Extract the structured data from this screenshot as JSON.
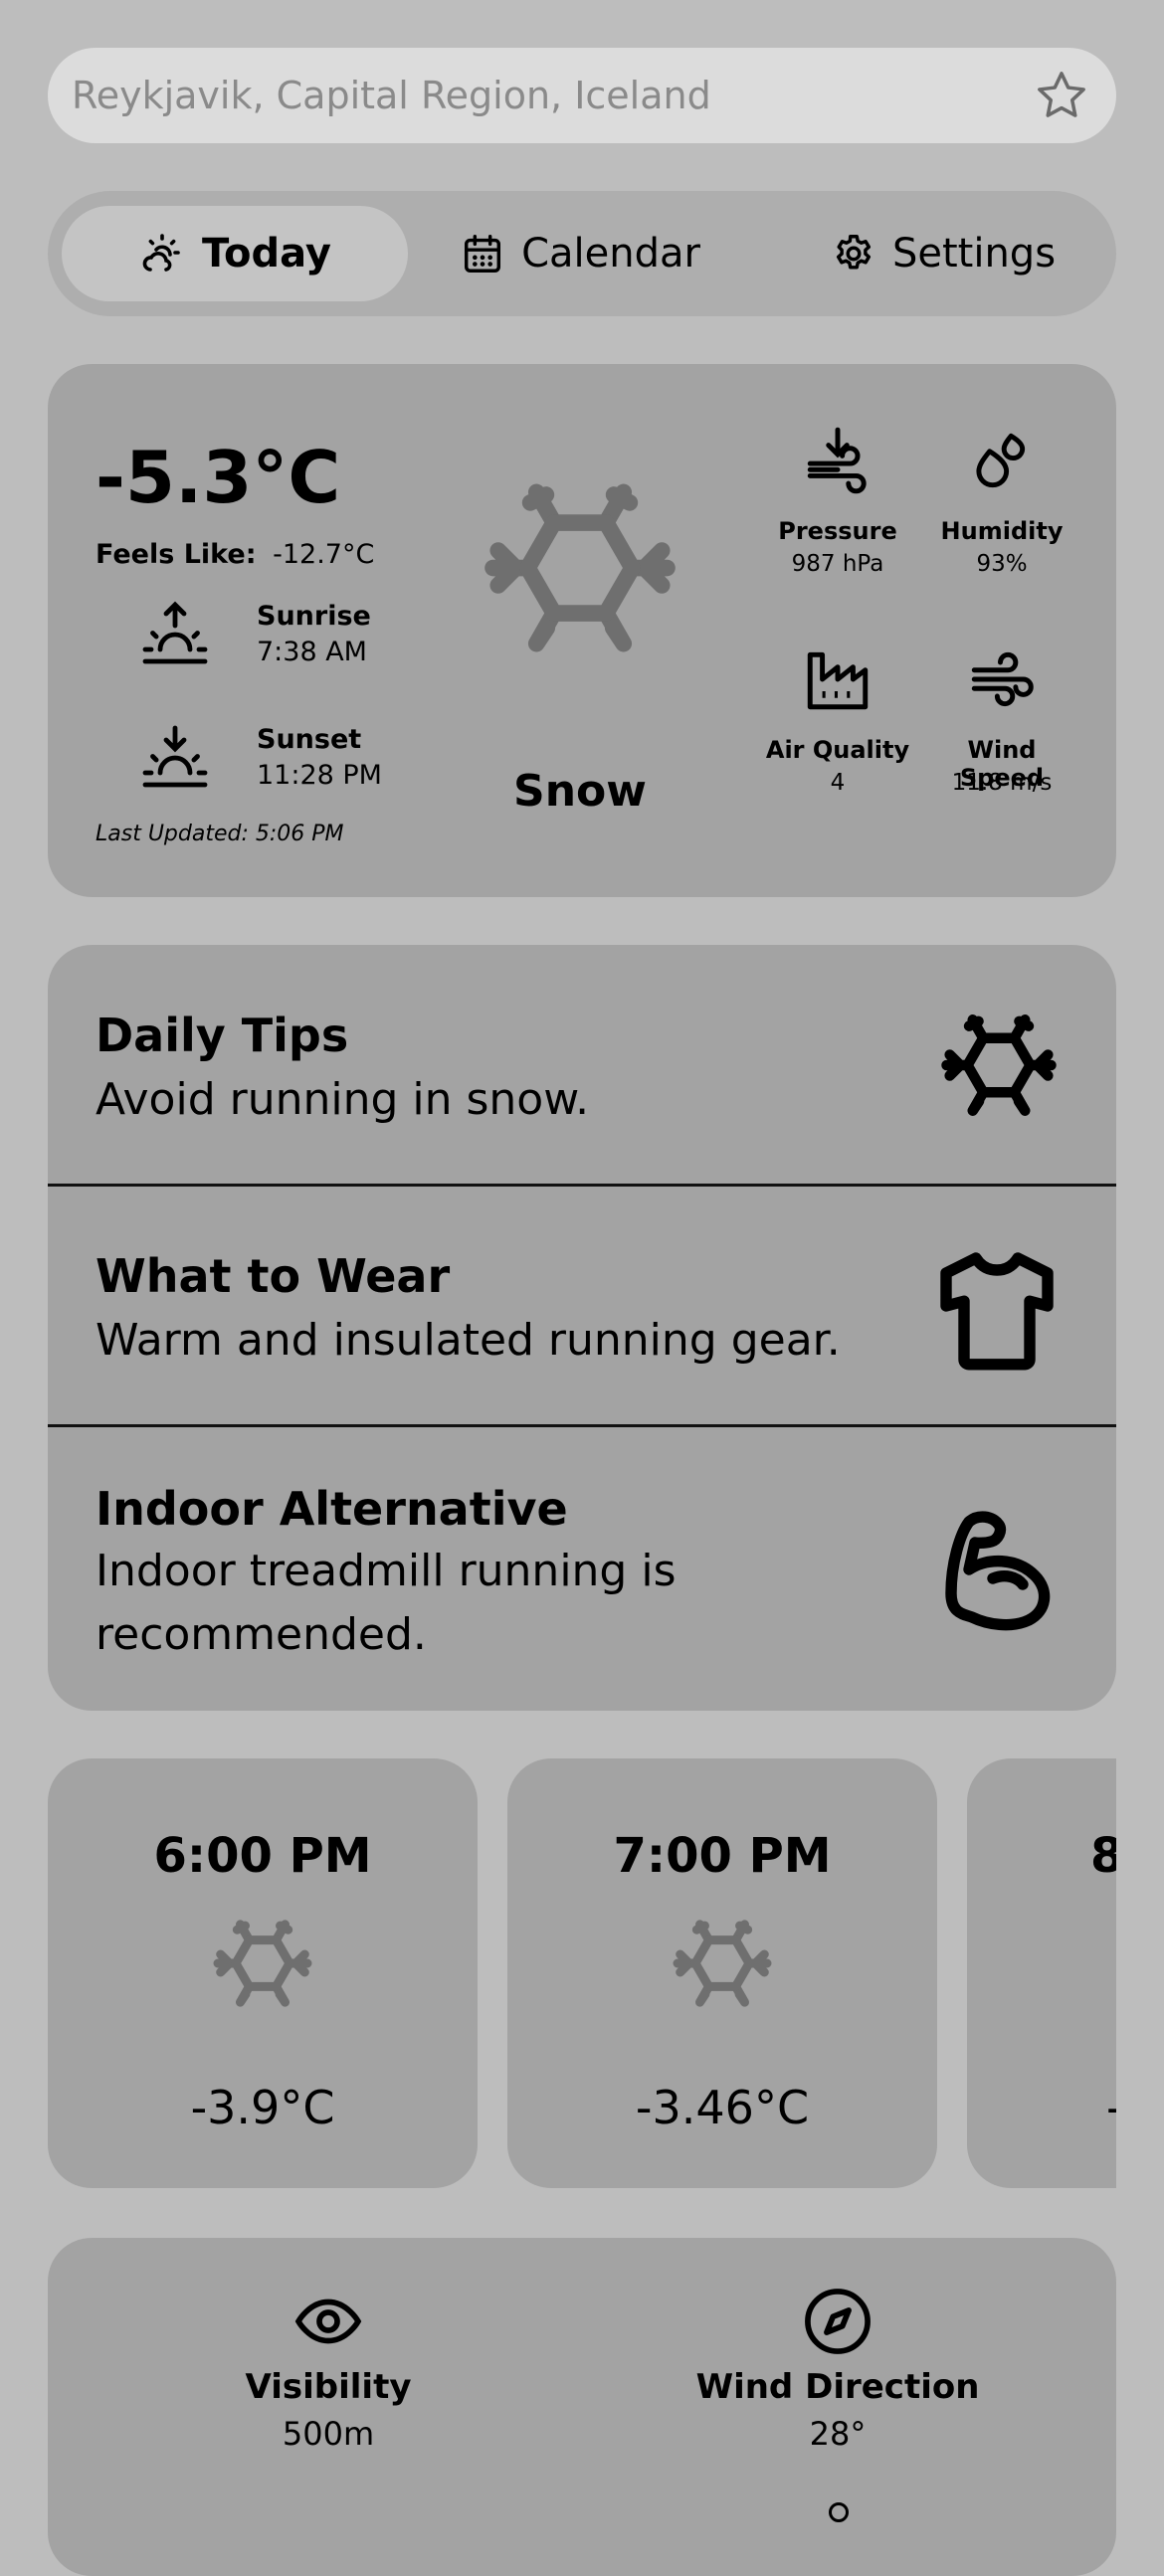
{
  "search": {
    "placeholder": "Reykjavik, Capital Region, Iceland",
    "favorite_icon": "star-icon"
  },
  "tabs": [
    {
      "label": "Today",
      "icon": "sun-cloud-icon",
      "active": true
    },
    {
      "label": "Calendar",
      "icon": "calendar-icon",
      "active": false
    },
    {
      "label": "Settings",
      "icon": "gear-icon",
      "active": false
    }
  ],
  "current": {
    "temperature": "-5.3°C",
    "feels_like_label": "Feels Like:",
    "feels_like_value": "-12.7°C",
    "sunrise_label": "Sunrise",
    "sunrise_time": "7:38 AM",
    "sunset_label": "Sunset",
    "sunset_time": "11:28 PM",
    "last_updated": "Last Updated: 5:06 PM",
    "condition": "Snow",
    "condition_icon": "snowflake-icon",
    "stats": [
      {
        "label": "Pressure",
        "value": "987 hPa",
        "icon": "pressure-icon"
      },
      {
        "label": "Humidity",
        "value": "93%",
        "icon": "droplets-icon"
      },
      {
        "label": "Air Quality",
        "value": "4",
        "icon": "factory-icon"
      },
      {
        "label": "Wind Speed",
        "value": "11.8 m/s",
        "icon": "wind-icon"
      }
    ]
  },
  "tips": [
    {
      "title": "Daily Tips",
      "desc": "Avoid running in snow.",
      "icon": "snowflake-icon"
    },
    {
      "title": "What to Wear",
      "desc": "Warm and insulated running gear.",
      "icon": "shirt-icon"
    },
    {
      "title": "Indoor Alternative",
      "desc_line1": "Indoor treadmill running is",
      "desc_line2": "recommended.",
      "icon": "biceps-icon"
    }
  ],
  "hourly": [
    {
      "time": "6:00 PM",
      "temp": "-3.9°C",
      "icon": "snowflake-icon"
    },
    {
      "time": "7:00 PM",
      "temp": "-3.46°C",
      "icon": "snowflake-icon"
    },
    {
      "time": "8",
      "temp": "-",
      "icon": "snowflake-icon"
    }
  ],
  "details": [
    {
      "label": "Visibility",
      "value": "500m",
      "icon": "eye-icon"
    },
    {
      "label": "Wind Direction",
      "value": "28°",
      "icon": "compass-icon"
    }
  ],
  "colors": {
    "background": "#bdbdbd",
    "card": "#a3a3a3",
    "muted_icon": "#6f6f6f"
  }
}
